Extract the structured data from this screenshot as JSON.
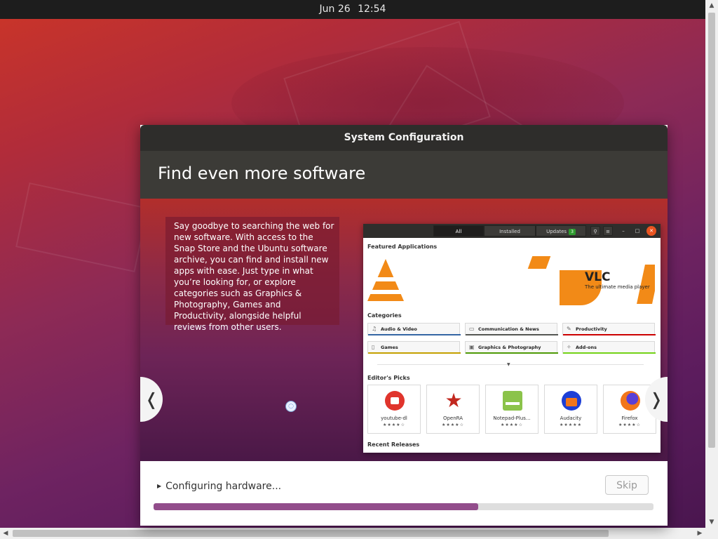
{
  "topbar": {
    "date": "Jun 26",
    "time": "12:54"
  },
  "dialog": {
    "title": "System Configuration",
    "heading": "Find even more software",
    "slide_text": "Say goodbye to searching the web for new software. With access to the Snap Store and the Ubuntu software archive, you can find and install new apps with ease. Just type in what you’re looking for, or explore categories such as Graphics & Photography, Games and Productivity, alongside helpful reviews from other users.",
    "prev_glyph": "❬",
    "next_glyph": "❭",
    "software_window": {
      "tabs": [
        "All",
        "Installed",
        "Updates"
      ],
      "updates_count": "3",
      "featured_label": "Featured Applications",
      "banner_title": "VLC",
      "banner_tagline": "The ultimate media player",
      "categories_label": "Categories",
      "categories": [
        {
          "label": "Audio & Video",
          "icon": "music-note-icon",
          "color": "#3465a4"
        },
        {
          "label": "Communication & News",
          "icon": "chat-icon",
          "color": "#555753"
        },
        {
          "label": "Productivity",
          "icon": "pencil-icon",
          "color": "#cc0000"
        },
        {
          "label": "Games",
          "icon": "gamepad-icon",
          "color": "#c4a000"
        },
        {
          "label": "Graphics & Photography",
          "icon": "image-icon",
          "color": "#4e9a06"
        },
        {
          "label": "Add-ons",
          "icon": "puzzle-icon",
          "color": "#73d216"
        }
      ],
      "editors_picks_label": "Editor's Picks",
      "picks": [
        {
          "name": "youtube-dl",
          "stars": "★★★★☆",
          "color": "#e0342c"
        },
        {
          "name": "OpenRA",
          "stars": "★★★★☆",
          "color": "#c2281f"
        },
        {
          "name": "Notepad-Plus...",
          "stars": "★★★★☆",
          "color": "#8bc34a"
        },
        {
          "name": "Audacity",
          "stars": "★★★★★",
          "color": "#1d3fd6"
        },
        {
          "name": "Firefox",
          "stars": "★★★★☆",
          "color": "#f2761b"
        }
      ],
      "recent_label": "Recent Releases"
    },
    "status_text": "Configuring hardware...",
    "skip_label": "Skip",
    "progress": 0.65
  },
  "colors": {
    "accent": "#924d8b",
    "titlebar": "#2e2d2b",
    "header": "#3c3b37"
  }
}
